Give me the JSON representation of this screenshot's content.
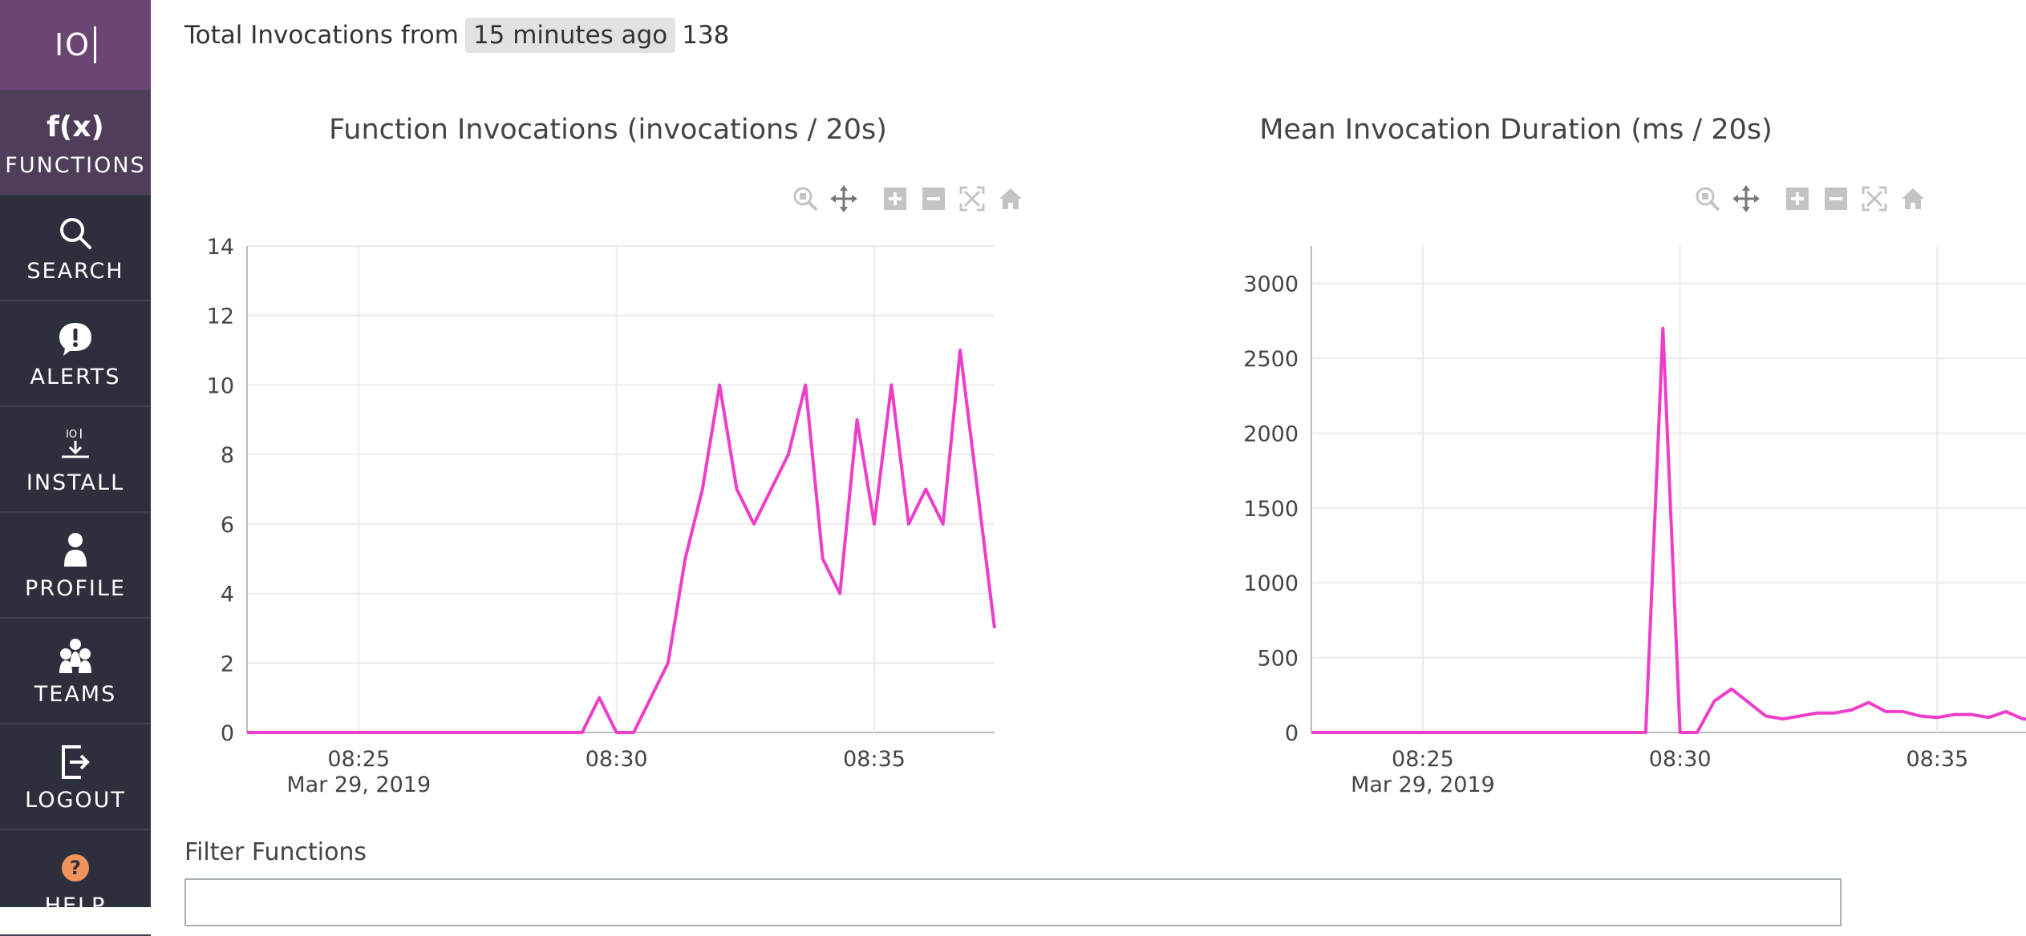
{
  "app": {
    "logo_text": "IO"
  },
  "sidebar": {
    "items": [
      {
        "label": "FUNCTIONS",
        "icon": "function-icon",
        "active": true
      },
      {
        "label": "SEARCH",
        "icon": "search-icon"
      },
      {
        "label": "ALERTS",
        "icon": "alert-icon"
      },
      {
        "label": "INSTALL",
        "icon": "install-icon"
      },
      {
        "label": "PROFILE",
        "icon": "profile-icon"
      },
      {
        "label": "TEAMS",
        "icon": "teams-icon"
      },
      {
        "label": "LOGOUT",
        "icon": "logout-icon"
      },
      {
        "label": "HELP",
        "icon": "help-icon"
      }
    ],
    "fx_glyph": "f(x)"
  },
  "summary": {
    "prefix": "Total Invocations from",
    "range": "15 minutes ago",
    "count": "138"
  },
  "filter": {
    "label": "Filter Functions"
  },
  "colors": {
    "line": "#ee3ec9",
    "sidebar_bg": "#2e2f3d",
    "logo_bg": "#6b4574",
    "active_bg": "#4f3d5a"
  },
  "chart_data": [
    {
      "type": "line",
      "title": "Function Invocations (invocations / 20s)",
      "xlabel": "",
      "ylabel": "",
      "x_ticks": [
        "08:25",
        "08:30",
        "08:35"
      ],
      "x_date_label": "Mar 29, 2019",
      "x_range": [
        "08:22:50",
        "08:37:20"
      ],
      "ylim": [
        0,
        14
      ],
      "y_ticks": [
        0,
        2,
        4,
        6,
        8,
        10,
        12,
        14
      ],
      "grid": true,
      "series": [
        {
          "x": [
            "08:22:50",
            "08:29:20",
            "08:29:40",
            "08:30:00",
            "08:30:20",
            "08:30:40",
            "08:31:00",
            "08:31:20",
            "08:31:40",
            "08:32:00",
            "08:32:20",
            "08:32:40",
            "08:33:00",
            "08:33:20",
            "08:33:40",
            "08:34:00",
            "08:34:20",
            "08:34:40",
            "08:35:00",
            "08:35:20",
            "08:35:40",
            "08:36:00",
            "08:36:20",
            "08:36:40",
            "08:37:00",
            "08:37:20"
          ],
          "y": [
            0,
            0,
            1,
            0,
            0,
            1,
            2,
            5,
            7,
            10,
            7,
            6,
            7,
            8,
            10,
            5,
            4,
            9,
            6,
            10,
            6,
            7,
            6,
            11,
            7,
            3
          ]
        }
      ]
    },
    {
      "type": "line",
      "title": "Mean Invocation Duration (ms / 20s)",
      "xlabel": "",
      "ylabel": "",
      "x_ticks": [
        "08:25",
        "08:30",
        "08:35"
      ],
      "x_date_label": "Mar 29, 2019",
      "x_range": [
        "08:22:50",
        "08:37:20"
      ],
      "ylim": [
        0,
        3250
      ],
      "y_ticks": [
        0,
        500,
        1000,
        1500,
        2000,
        2500,
        3000
      ],
      "grid": true,
      "series": [
        {
          "x": [
            "08:22:50",
            "08:29:20",
            "08:29:40",
            "08:30:00",
            "08:30:20",
            "08:30:40",
            "08:31:00",
            "08:31:20",
            "08:31:40",
            "08:32:00",
            "08:32:20",
            "08:32:40",
            "08:33:00",
            "08:33:20",
            "08:33:40",
            "08:34:00",
            "08:34:20",
            "08:34:40",
            "08:35:00",
            "08:35:20",
            "08:35:40",
            "08:36:00",
            "08:36:20",
            "08:36:40",
            "08:37:00",
            "08:37:20"
          ],
          "y": [
            0,
            0,
            2700,
            0,
            0,
            210,
            290,
            200,
            110,
            90,
            110,
            130,
            130,
            150,
            200,
            140,
            140,
            110,
            100,
            120,
            120,
            100,
            140,
            90,
            90,
            80
          ]
        }
      ]
    }
  ]
}
